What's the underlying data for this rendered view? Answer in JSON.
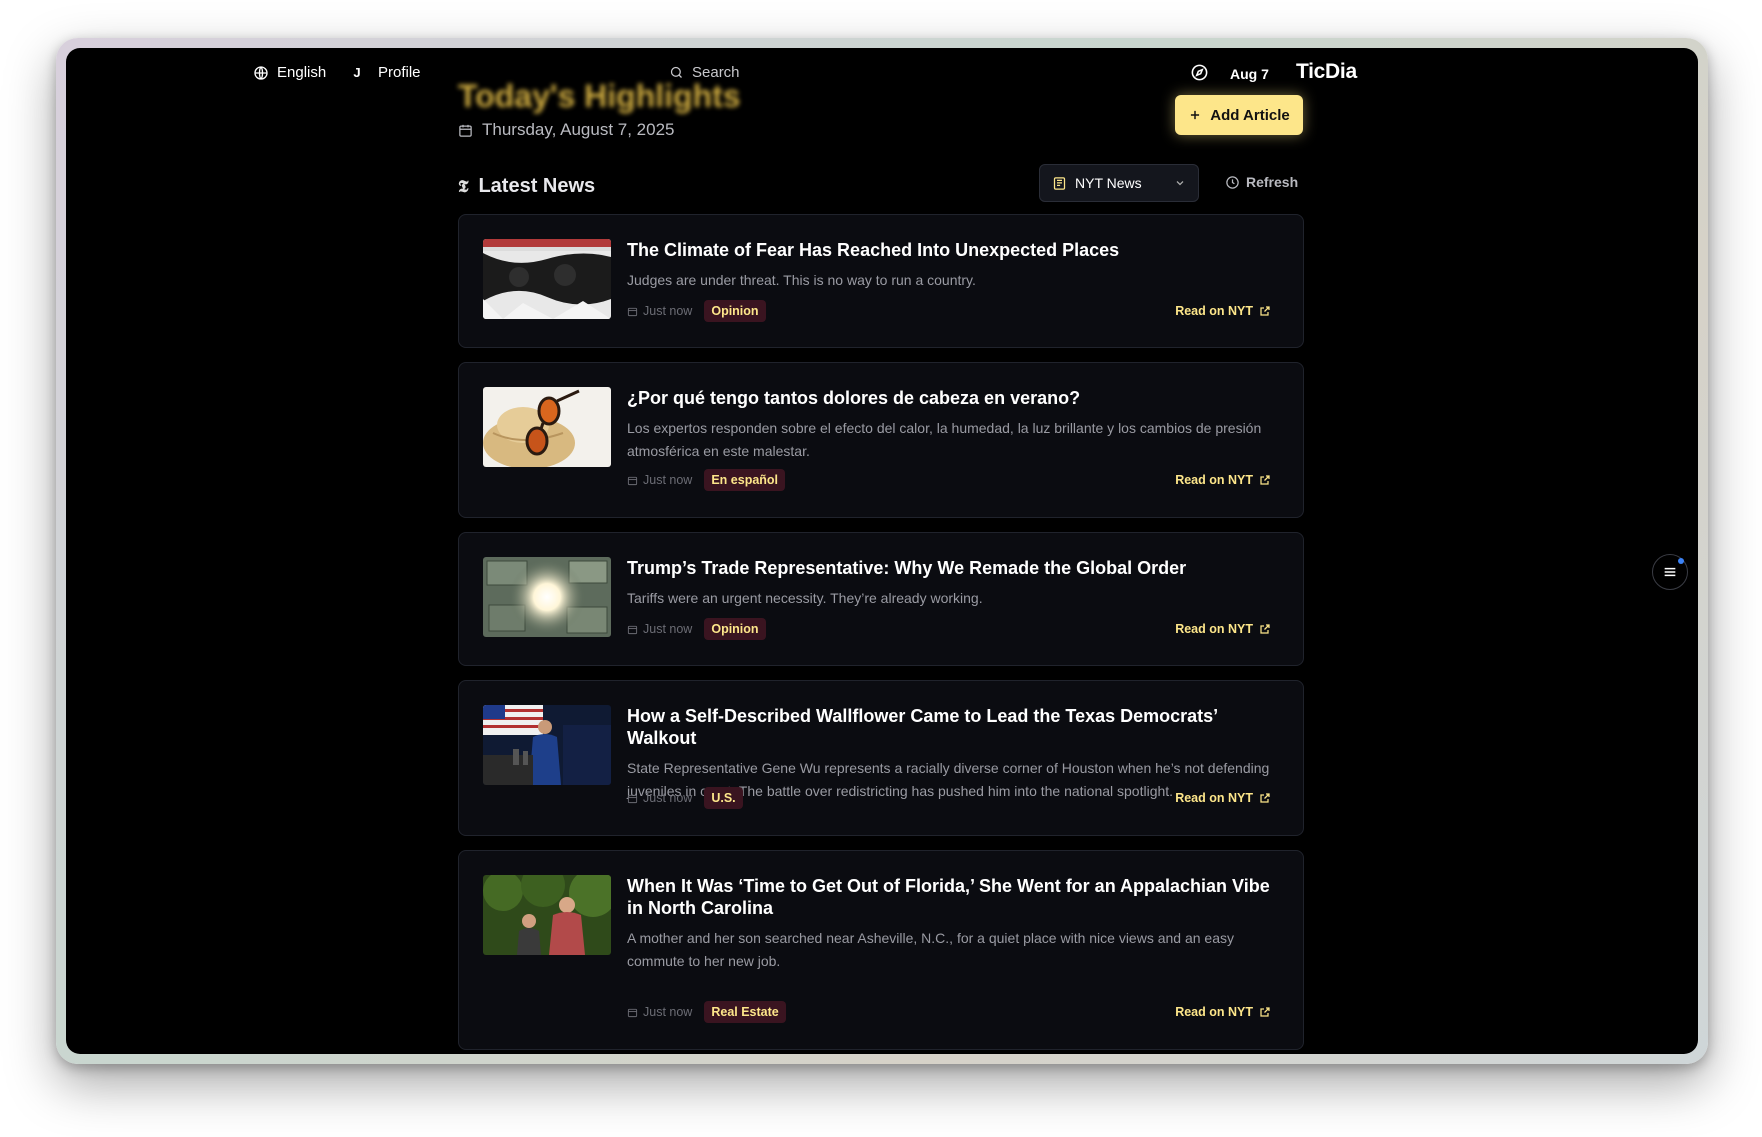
{
  "topbar": {
    "language": "English",
    "profile_initial": "J",
    "profile_label": "Profile",
    "search_label": "Search",
    "date_short": "Aug 7",
    "brand": "TicDia"
  },
  "hero": {
    "title": "Today's Highlights",
    "date": "Thursday, August 7, 2025",
    "add_button": "Add Article"
  },
  "section": {
    "title": "Latest News",
    "source_selected": "NYT News",
    "refresh_label": "Refresh"
  },
  "articles": [
    {
      "title": "The Climate of Fear Has Reached Into Unexpected Places",
      "description": "Judges are under threat. This is no way to run a country.",
      "time": "Just now",
      "category": "Opinion",
      "link_label": "Read on NYT"
    },
    {
      "title": "¿Por qué tengo tantos dolores de cabeza en verano?",
      "description": "Los expertos responden sobre el efecto del calor, la humedad, la luz brillante y los cambios de presión atmosférica en este malestar.",
      "time": "Just now",
      "category": "En español",
      "link_label": "Read on NYT"
    },
    {
      "title": "Trump’s Trade Representative: Why We Remade the Global Order",
      "description": "Tariffs were an urgent necessity. They’re already working.",
      "time": "Just now",
      "category": "Opinion",
      "link_label": "Read on NYT"
    },
    {
      "title": "How a Self-Described Wallflower Came to Lead the Texas Democrats’ Walkout",
      "description": "State Representative Gene Wu represents a racially diverse corner of Houston when he’s not defending juveniles in court. The battle over redistricting has pushed him into the national spotlight.",
      "time": "Just now",
      "category": "U.S.",
      "link_label": "Read on NYT"
    },
    {
      "title": "When It Was ‘Time to Get Out of Florida,’ She Went for an Appalachian Vibe in North Carolina",
      "description": "A mother and her son searched near Asheville, N.C., for a quiet place with nice views and an easy commute to her new job.",
      "time": "Just now",
      "category": "Real Estate",
      "link_label": "Read on NYT"
    }
  ],
  "colors": {
    "accent": "#fde68a",
    "background": "#000000",
    "card": "#0b0c11",
    "badge_bg": "#3a1420"
  }
}
